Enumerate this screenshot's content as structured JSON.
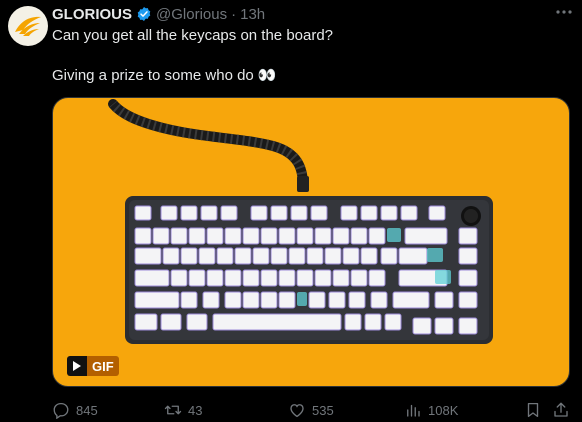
{
  "post": {
    "author_name": "GLORIOUS",
    "handle": "@Glorious",
    "separator": "·",
    "time": "13h",
    "text_line1": "Can you get all the keycaps on the board?",
    "text_line2": "Giving a prize to some who do 👀",
    "media": {
      "badge_label": "GIF",
      "background_color": "#f7a60c"
    }
  },
  "actions": {
    "replies": "845",
    "reposts": "43",
    "likes": "535",
    "views": "108K"
  },
  "icons": [
    "brand-logo-icon",
    "verified-badge-icon",
    "more-options-icon",
    "play-icon",
    "reply-icon",
    "repost-icon",
    "like-icon",
    "views-icon",
    "bookmark-icon",
    "share-icon"
  ],
  "colors": {
    "accent": "#1d9bf0",
    "muted": "#71767b",
    "text": "#e7e9ea",
    "background": "#000000"
  }
}
